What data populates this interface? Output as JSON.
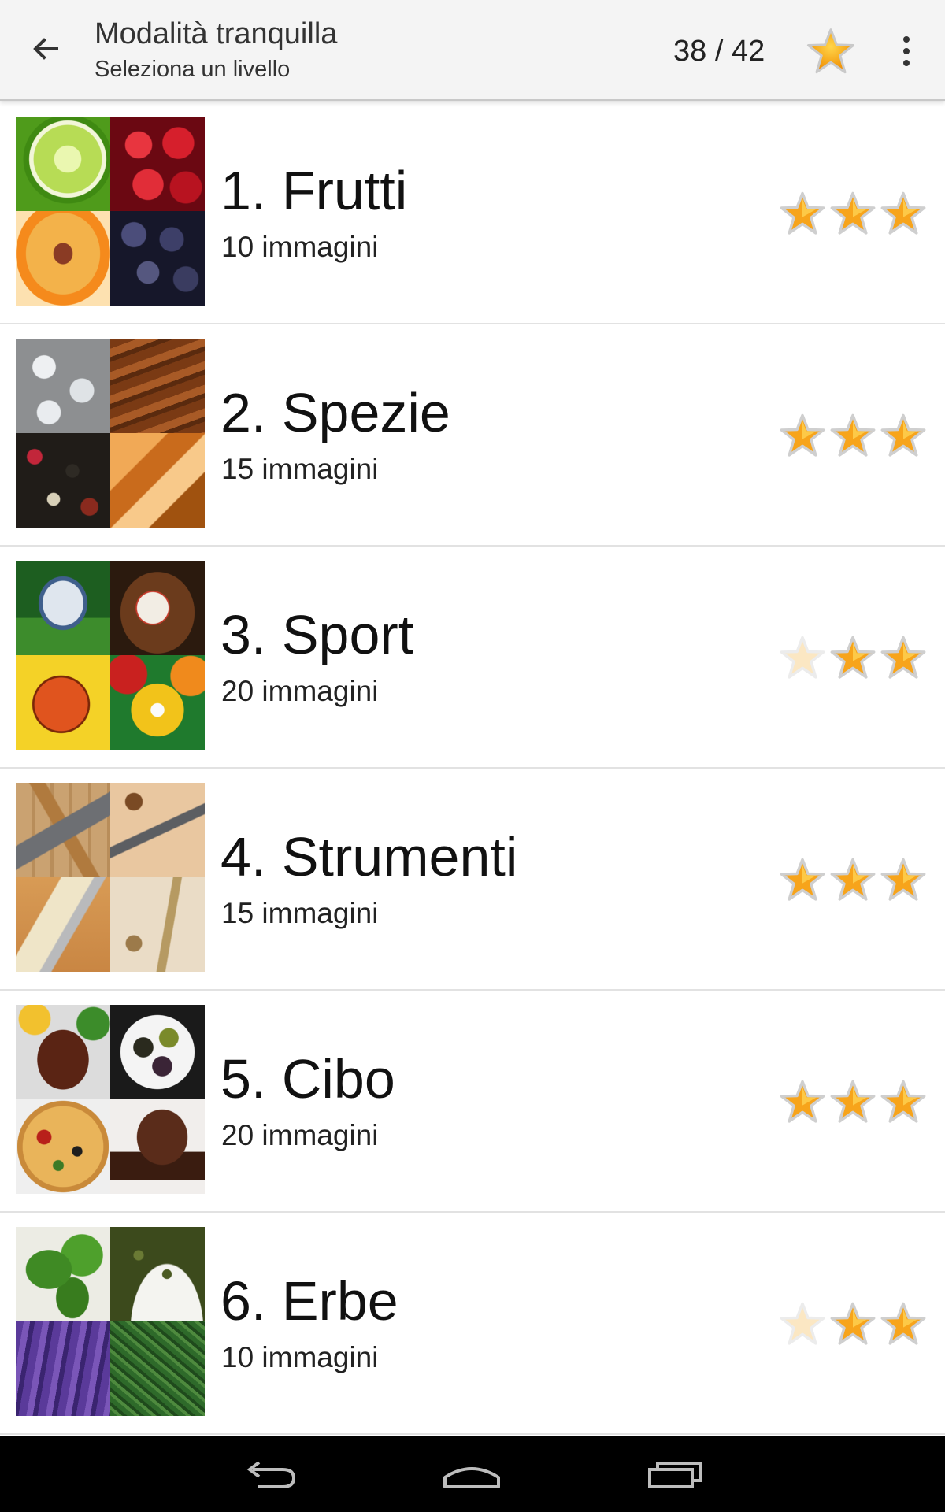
{
  "appbar": {
    "title": "Modalità tranquilla",
    "subtitle": "Seleziona un livello",
    "counter": "38 / 42",
    "back_icon": "arrow-left-icon",
    "star_icon": "star-icon",
    "menu_icon": "overflow-menu-icon"
  },
  "colors": {
    "star_fill": "#f7a41b",
    "star_faded": "#fbe7c3",
    "appbar_bg": "#f4f4f4",
    "navbar_bg": "#000000"
  },
  "levels": [
    {
      "title": "1. Frutti",
      "count": "10 immagini",
      "stars_earned": 3,
      "stars_total": 3,
      "thumbnail": [
        "lime",
        "cranberries",
        "peach",
        "blueberries"
      ]
    },
    {
      "title": "2. Spezie",
      "count": "15 immagini",
      "stars_earned": 3,
      "stars_total": 3,
      "thumbnail": [
        "salt",
        "cinnamon",
        "peppercorns",
        "rock-sugar"
      ]
    },
    {
      "title": "3. Sport",
      "count": "20 immagini",
      "stars_earned": 2,
      "stars_total": 3,
      "thumbnail": [
        "football-helmet",
        "baseball-glove",
        "basketball",
        "billiard-balls"
      ]
    },
    {
      "title": "4. Strumenti",
      "count": "15 immagini",
      "stars_earned": 3,
      "stars_total": 3,
      "thumbnail": [
        "hammer",
        "drill-bit",
        "paint-brush",
        "screw"
      ]
    },
    {
      "title": "5. Cibo",
      "count": "20 immagini",
      "stars_earned": 3,
      "stars_total": 3,
      "thumbnail": [
        "steak",
        "olives",
        "pizza",
        "muffin"
      ]
    },
    {
      "title": "6. Erbe",
      "count": "10 immagini",
      "stars_earned": 2,
      "stars_total": 3,
      "thumbnail": [
        "basil",
        "dried-oregano",
        "lavender",
        "rosemary"
      ]
    }
  ],
  "navbar": {
    "back_icon": "nav-back-icon",
    "home_icon": "nav-home-icon",
    "recents_icon": "nav-recents-icon"
  }
}
